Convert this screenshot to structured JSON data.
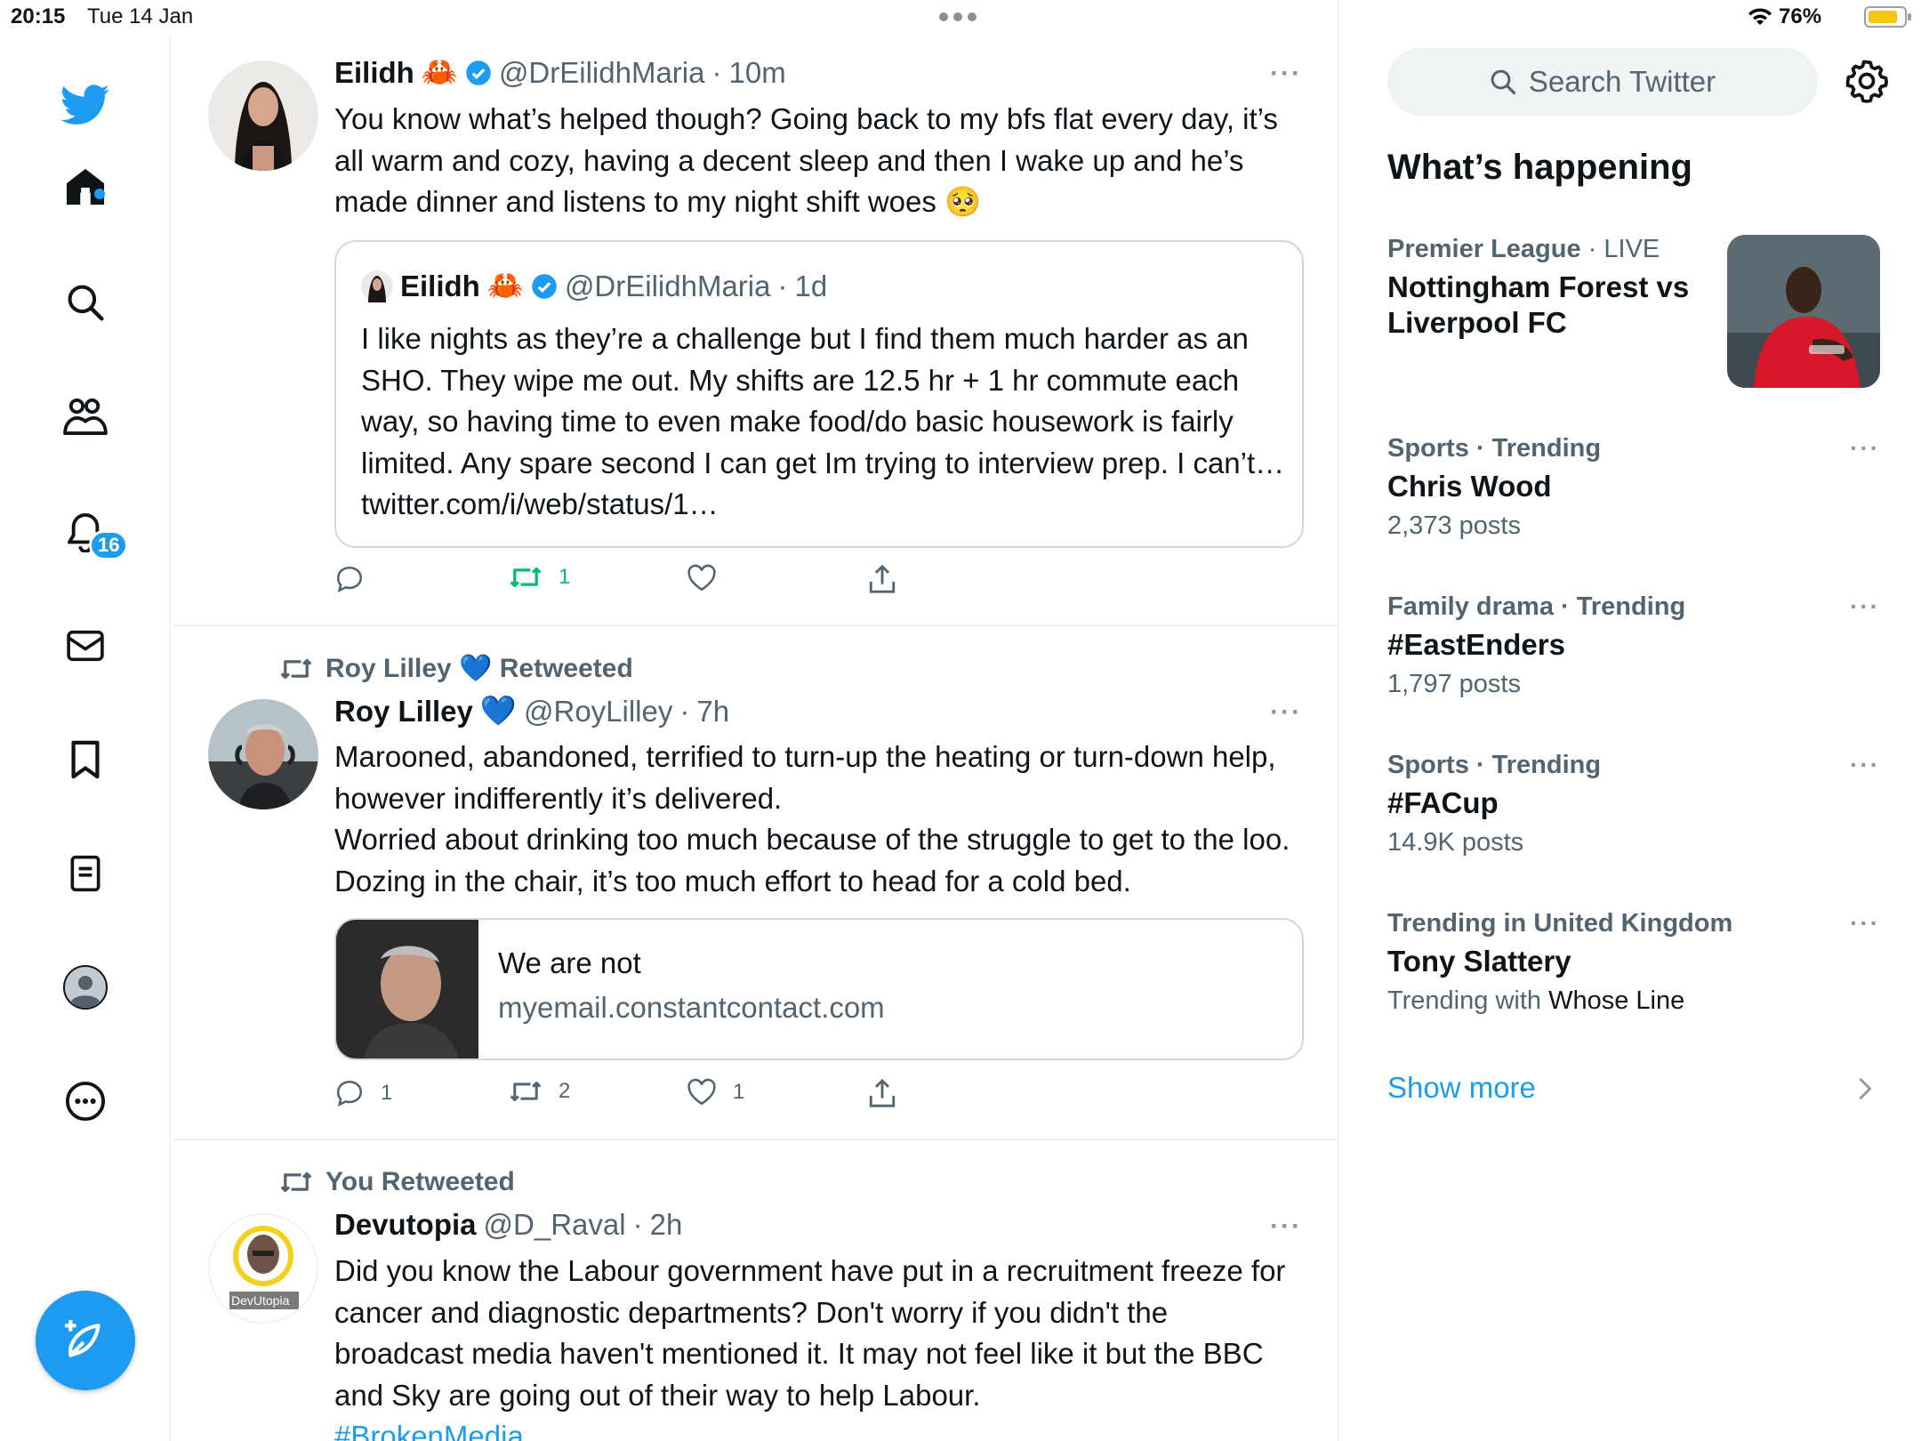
{
  "status_bar": {
    "time": "20:15",
    "date": "Tue 14 Jan",
    "battery": "76%"
  },
  "colors": {
    "accent": "#1d9bf0",
    "retweet": "#00ba7c",
    "text": "#0f1419",
    "muted": "#536471"
  },
  "nav": {
    "items": [
      "twitter-logo",
      "home",
      "search",
      "communities",
      "notifications",
      "messages",
      "bookmarks",
      "lists",
      "profile",
      "more"
    ],
    "notification_count": "16"
  },
  "timeline": {
    "tweet1": {
      "name": "Eilidh",
      "emoji": "🦀",
      "handle": "@DrEilidhMaria",
      "dot": "·",
      "time": "10m",
      "text": "You know what’s helped though? Going back to my bfs flat every day, it’s all warm and cozy, having a decent sleep and then I wake up and he’s made dinner and listens to my night shift woes 🥺",
      "quote": {
        "name": "Eilidh",
        "emoji": "🦀",
        "handle": "@DrEilidhMaria",
        "dot": "·",
        "time": "1d",
        "text": "I like nights as they’re a challenge but I find them much harder as an SHO. They wipe me out. My shifts are 12.5 hr + 1 hr commute each way, so having time to even make food/do basic housework is fairly limited. Any spare second I can get Im trying to interview prep. I can’t… twitter.com/i/web/status/1…"
      },
      "retweets": "1"
    },
    "tweet2": {
      "retweeted_by": "Roy Lilley 💙 Retweeted",
      "name": "Roy Lilley",
      "emoji": "💙",
      "handle": "@RoyLilley",
      "dot": "·",
      "time": "7h",
      "text1": "Marooned, abandoned,  terrified to turn-up the heating or turn-down help, however indifferently it’s delivered.",
      "text2": "Worried about drinking too much because of the struggle to get to the loo. Dozing in the chair, it’s too much effort to head for a cold bed.",
      "card": {
        "title": "We are not",
        "domain": "myemail.constantcontact.com"
      },
      "replies": "1",
      "retweets": "2",
      "likes": "1"
    },
    "tweet3": {
      "retweeted_by": "You Retweeted",
      "name": "Devutopia",
      "handle": "@D_Raval",
      "dot": "·",
      "time": "2h",
      "avatar_label": "DevUtopia",
      "text": "Did you know the Labour government have put in a recruitment freeze for cancer and diagnostic departments? Don't worry if you didn't the broadcast media haven't mentioned it. It may not feel like it but the BBC and Sky are going out of their way to help Labour.",
      "hashtag": "#BrokenMedia"
    }
  },
  "sidebar": {
    "search_placeholder": "Search Twitter",
    "title": "What’s happening",
    "trends": [
      {
        "category": "Premier League",
        "dot": "·",
        "status": "LIVE",
        "name": "Nottingham Forest vs Liverpool FC"
      },
      {
        "category": "Sports · Trending",
        "name": "Chris Wood",
        "count": "2,373 posts"
      },
      {
        "category": "Family drama · Trending",
        "name": "#EastEnders",
        "count": "1,797 posts"
      },
      {
        "category": "Sports · Trending",
        "name": "#FACup",
        "count": "14.9K posts"
      },
      {
        "category": "Trending in United Kingdom",
        "name": "Tony Slattery",
        "count_prefix": "Trending with",
        "count_link": "Whose Line"
      }
    ],
    "show_more": "Show more"
  }
}
